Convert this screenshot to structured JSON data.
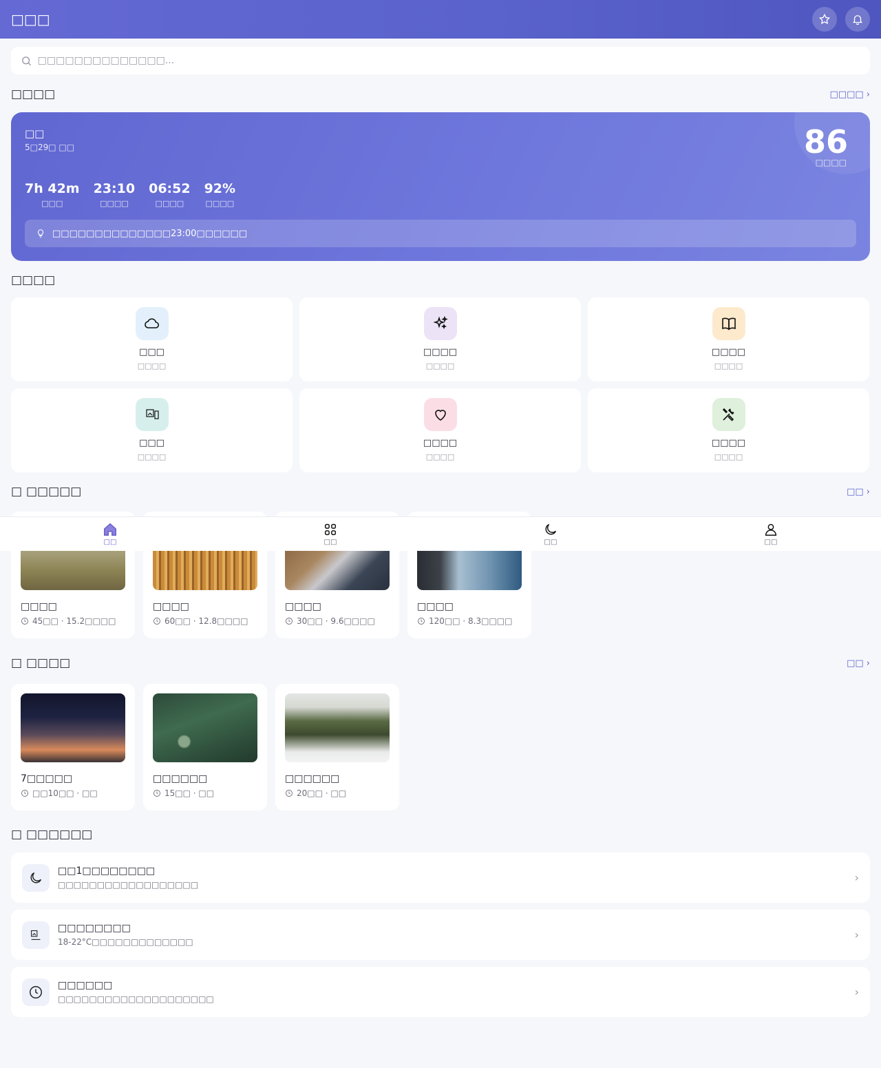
{
  "header": {
    "title": "□□□"
  },
  "search": {
    "placeholder": "□□□□□□□□□□□□□□..."
  },
  "sleep_section": {
    "title": "□□□□",
    "link": "□□□□ ›",
    "label": "□□",
    "date": "5□29□ □□",
    "score": "86",
    "score_label": "□□□□",
    "stats": [
      {
        "value": "7h 42m",
        "label": "□□□"
      },
      {
        "value": "23:10",
        "label": "□□□□"
      },
      {
        "value": "06:52",
        "label": "□□□□"
      },
      {
        "value": "92%",
        "label": "□□□□"
      }
    ],
    "tip": "□□□□□□□□□□□□□□23:00□□□□□□"
  },
  "quick": {
    "title": "□□□□",
    "items": [
      {
        "name": "□□□",
        "sub": "□□□□",
        "icon": "cloud-icon",
        "bg": "#e3f0fb"
      },
      {
        "name": "□□□□",
        "sub": "□□□□",
        "icon": "sparkles-icon",
        "bg": "#ece3f7"
      },
      {
        "name": "□□□□",
        "sub": "□□□□",
        "icon": "book-icon",
        "bg": "#fdeacd"
      },
      {
        "name": "□□□",
        "sub": "□□□□",
        "icon": "broken-image-icon",
        "bg": "#d7efec"
      },
      {
        "name": "□□□□",
        "sub": "□□□□",
        "icon": "heart-icon",
        "bg": "#fbdde6"
      },
      {
        "name": "□□□□",
        "sub": "□□□□",
        "icon": "tools-icon",
        "bg": "#dff0dc"
      }
    ]
  },
  "sounds": {
    "title": "□ □□□□□",
    "link": "□□ ›",
    "items": [
      {
        "title": "□□□□",
        "meta": "45□□ · 15.2□□□□"
      },
      {
        "title": "□□□□",
        "meta": "60□□ · 12.8□□□□"
      },
      {
        "title": "□□□□",
        "meta": "30□□ · 9.6□□□□"
      },
      {
        "title": "□□□□",
        "meta": "120□□ · 8.3□□□□"
      }
    ]
  },
  "courses": {
    "title": "□ □□□□",
    "link": "□□ ›",
    "items": [
      {
        "title": "7□□□□□",
        "meta": "□□10□□ · □□"
      },
      {
        "title": "□□□□□□",
        "meta": "15□□ · □□"
      },
      {
        "title": "□□□□□□",
        "meta": "20□□ · □□"
      }
    ]
  },
  "tips": {
    "title": "□ □□□□□□",
    "items": [
      {
        "title": "□□1□□□□□□□□",
        "sub": "□□□□□□□□□□□□□□□□□□",
        "icon": "moon-icon"
      },
      {
        "title": "□□□□□□□□",
        "sub": "18-22°C□□□□□□□□□□□□□",
        "icon": "broken-image-icon"
      },
      {
        "title": "□□□□□□",
        "sub": "□□□□□□□□□□□□□□□□□□□□",
        "icon": "clock-icon"
      }
    ]
  },
  "tabbar": {
    "items": [
      {
        "label": "□□",
        "icon": "home-icon"
      },
      {
        "label": "□□",
        "icon": "grid-icon"
      },
      {
        "label": "□□",
        "icon": "moon-icon"
      },
      {
        "label": "□□",
        "icon": "user-icon"
      }
    ]
  }
}
